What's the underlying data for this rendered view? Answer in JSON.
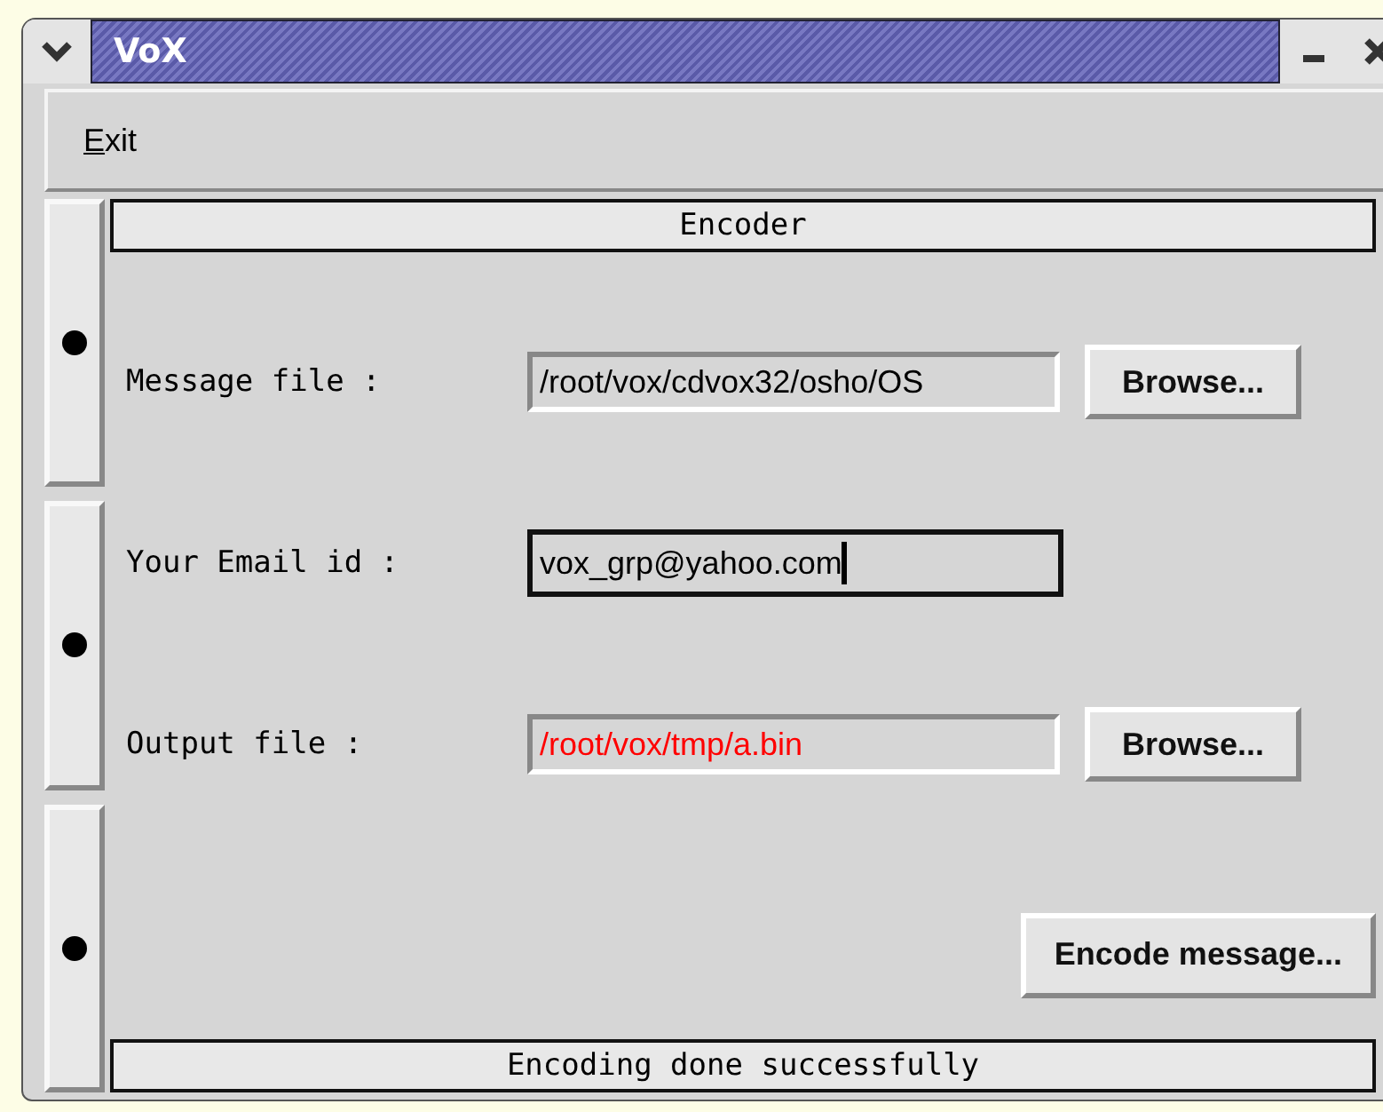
{
  "window": {
    "title": "VoX"
  },
  "menu": [
    {
      "label": "Exit"
    }
  ],
  "section_title": "Encoder",
  "fields": [
    {
      "label": "Message file :",
      "value": "/root/vox/cdvox32/osho/OS",
      "focused": false,
      "color": "#000000",
      "button": "Browse..."
    },
    {
      "label": "Your Email id :",
      "value": "vox_grp@yahoo.com",
      "focused": true,
      "color": "#000000"
    },
    {
      "label": "Output file :",
      "value": "/root/vox/tmp/a.bin",
      "focused": false,
      "color": "#ff0000",
      "button": "Browse..."
    }
  ],
  "action_button": "Encode message...",
  "status_bar": "Encoding done successfully"
}
